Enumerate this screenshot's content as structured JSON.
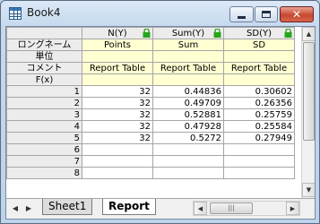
{
  "window": {
    "title": "Book4",
    "close_glyph": "✕"
  },
  "columns": [
    {
      "header": "N(Y)",
      "long_name": "Points",
      "units": "",
      "comment": "Report Table",
      "fx": ""
    },
    {
      "header": "Sum(Y)",
      "long_name": "Sum",
      "units": "",
      "comment": "Report Table",
      "fx": ""
    },
    {
      "header": "SD(Y)",
      "long_name": "SD",
      "units": "",
      "comment": "Report Table",
      "fx": ""
    }
  ],
  "row_labels": {
    "long_name": "ロングネーム",
    "units": "単位",
    "comment": "コメント",
    "fx": "F(x)"
  },
  "rows": [
    {
      "n": "1",
      "cells": [
        "32",
        "0.44836",
        "0.30602"
      ]
    },
    {
      "n": "2",
      "cells": [
        "32",
        "0.49709",
        "0.26356"
      ]
    },
    {
      "n": "3",
      "cells": [
        "32",
        "0.52881",
        "0.25759"
      ]
    },
    {
      "n": "4",
      "cells": [
        "32",
        "0.47928",
        "0.25584"
      ]
    },
    {
      "n": "5",
      "cells": [
        "32",
        "0.5272",
        "0.27949"
      ]
    },
    {
      "n": "6",
      "cells": [
        "",
        "",
        ""
      ]
    },
    {
      "n": "7",
      "cells": [
        "",
        "",
        ""
      ]
    },
    {
      "n": "8",
      "cells": [
        "",
        "",
        ""
      ]
    }
  ],
  "tabs": [
    {
      "label": "Sheet1",
      "active": false
    },
    {
      "label": "Report",
      "active": true
    }
  ],
  "nav": {
    "prev": "◀",
    "next": "▶"
  },
  "colors": {
    "lock": "#27a51c",
    "label_bg": "#ffffd2",
    "header_bg": "#ececec"
  }
}
